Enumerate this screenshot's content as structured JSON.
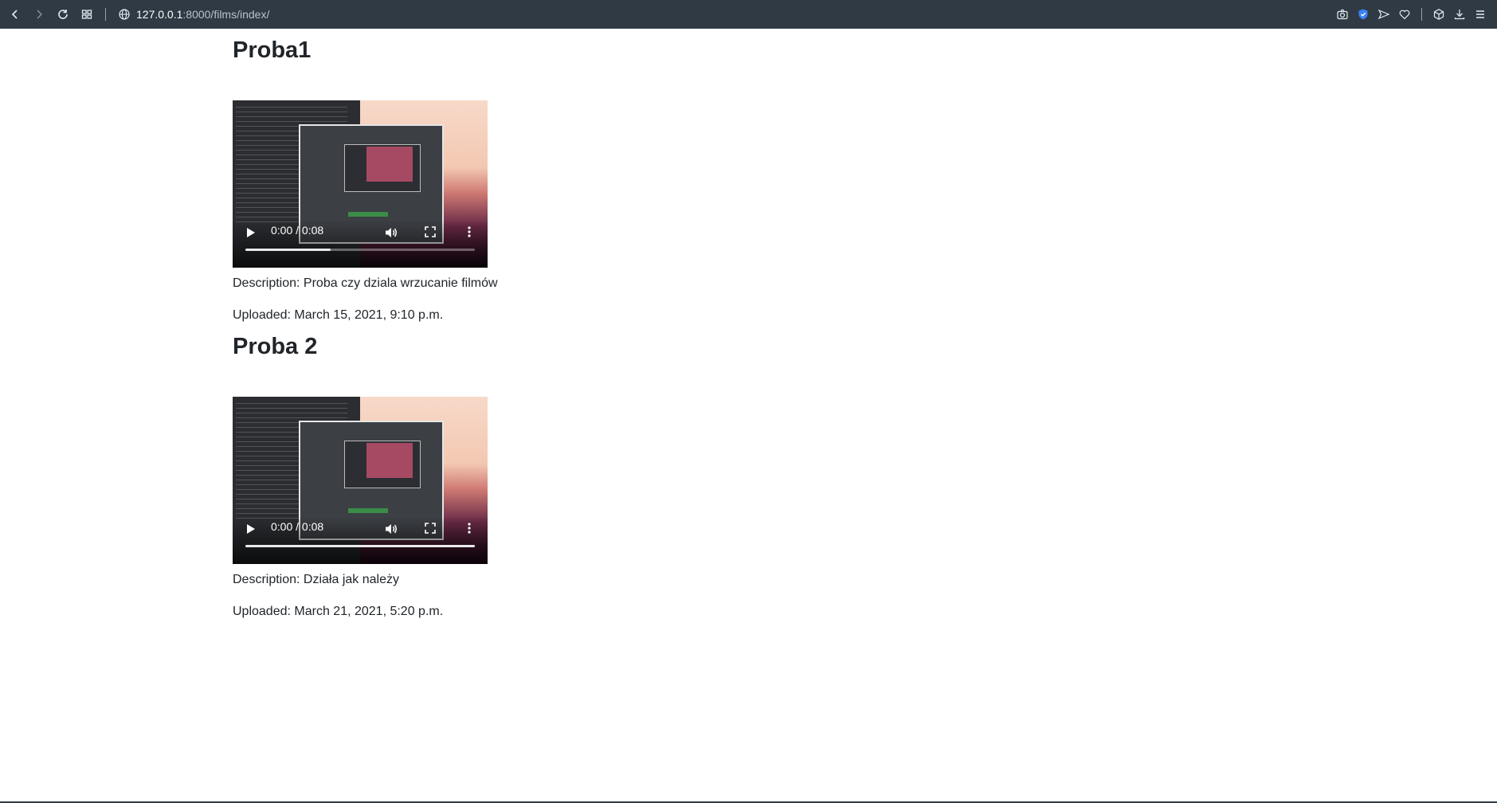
{
  "browser": {
    "url_host": "127.0.0.1",
    "url_path": ":8000/films/index/"
  },
  "films": [
    {
      "title": "Proba1",
      "video_time": "0:00 / 0:08",
      "description": "Description: Proba czy dziala wrzucanie filmów",
      "uploaded": "Uploaded: March 15, 2021, 9:10 p.m.",
      "buffered_fraction": 0.37
    },
    {
      "title": "Proba 2",
      "video_time": "0:00 / 0:08",
      "description": "Description: Działa jak należy",
      "uploaded": "Uploaded: March 21, 2021, 5:20 p.m.",
      "buffered_fraction": 1.0
    }
  ]
}
